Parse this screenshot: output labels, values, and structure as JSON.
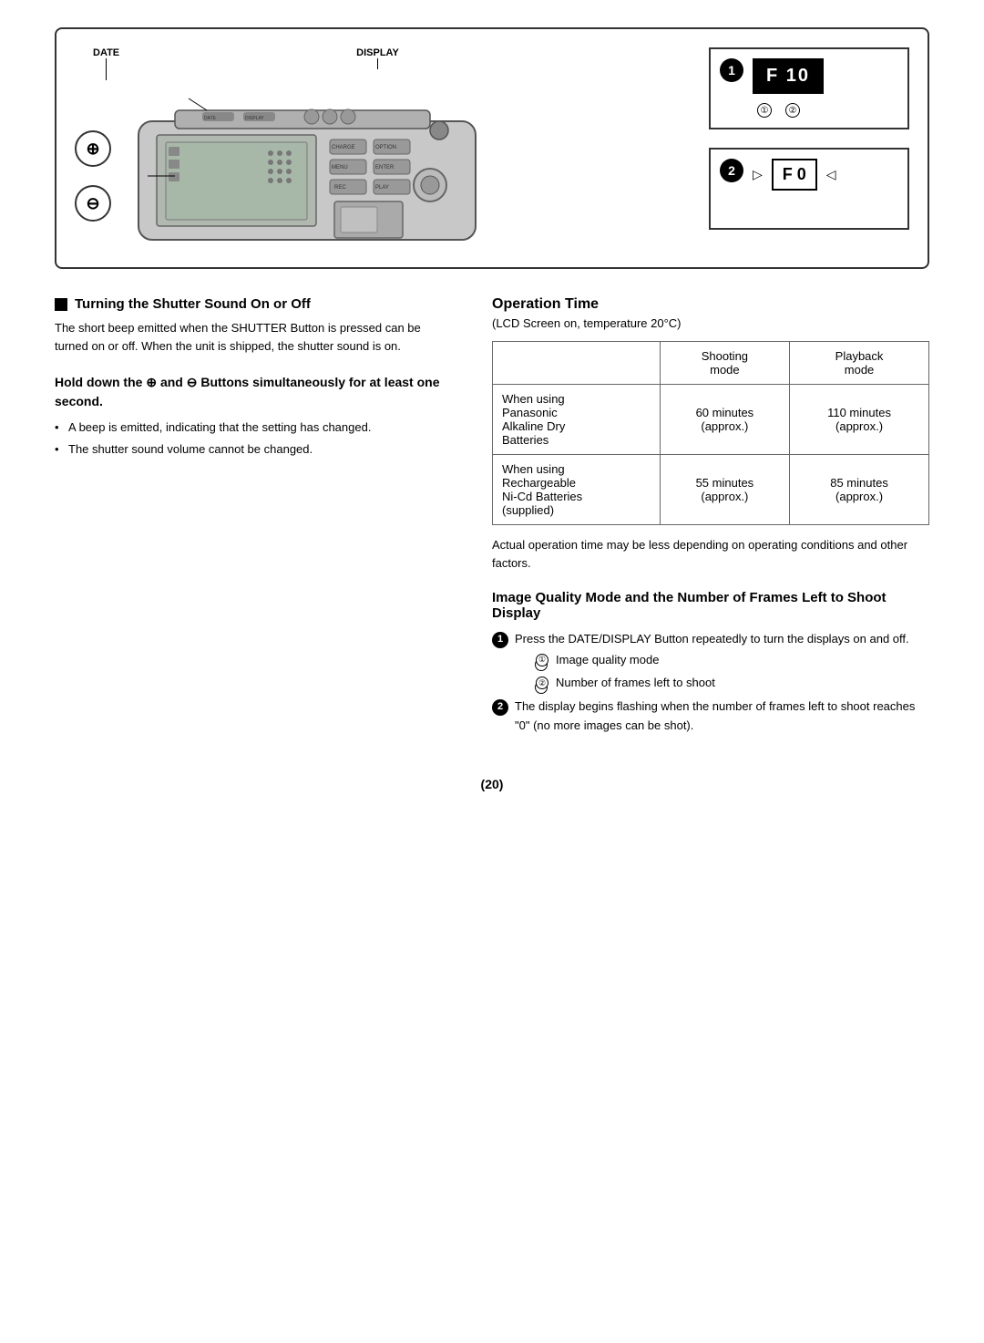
{
  "page": {
    "number": "(20)"
  },
  "diagram": {
    "top_label_date": "DATE",
    "top_label_display": "DISPLAY",
    "diagram1_number": "1",
    "diagram1_display": "F 10",
    "diagram1_sub1": "①",
    "diagram1_sub2": "②",
    "diagram2_number": "2",
    "diagram2_display": "F 0",
    "diagram2_arrow_left": "▷",
    "diagram2_arrow_right": "◁",
    "plus_symbol": "⊕",
    "minus_symbol": "⊖"
  },
  "left_section": {
    "title_icon": "■",
    "title": "Turning the Shutter Sound On or Off",
    "body": "The short beep emitted when the SHUTTER Button is pressed can be turned on or off. When the unit is shipped, the shutter sound is on.",
    "hold_title": "Hold down the ⊕ and ⊖ Buttons simultaneously for at least one second.",
    "bullets": [
      "A beep is emitted, indicating that the setting has changed.",
      "The shutter sound volume cannot be changed."
    ]
  },
  "right_section": {
    "operation_time_title": "Operation Time",
    "operation_time_subtitle": "(LCD Screen on, temperature 20°C)",
    "table": {
      "col1_header": "",
      "col2_header_line1": "Shooting",
      "col2_header_line2": "mode",
      "col3_header_line1": "Playback",
      "col3_header_line2": "mode",
      "rows": [
        {
          "label_line1": "When using",
          "label_line2": "Panasonic",
          "label_line3": "Alkaline Dry",
          "label_line4": "Batteries",
          "col2": "60 minutes (approx.)",
          "col3": "110 minutes (approx.)"
        },
        {
          "label_line1": "When using",
          "label_line2": "Rechargeable",
          "label_line3": "Ni-Cd Batteries",
          "label_line4": "(supplied)",
          "col2": "55 minutes (approx.)",
          "col3": "85 minutes (approx.)"
        }
      ]
    },
    "table_note": "Actual operation time may be less depending on operating conditions and other factors.",
    "image_quality_title": "Image Quality Mode and the Number of Frames Left to Shoot Display",
    "numbered_items": [
      {
        "number": "1",
        "text": "Press the DATE/DISPLAY Button repeatedly to turn the displays on and off.",
        "sub_items": [
          {
            "num": "①",
            "text": "Image quality mode"
          },
          {
            "num": "②",
            "text": "Number of frames left to shoot"
          }
        ]
      },
      {
        "number": "2",
        "text": "The display begins flashing when the number of frames left to shoot reaches \"0\" (no more images can be shot)."
      }
    ]
  }
}
